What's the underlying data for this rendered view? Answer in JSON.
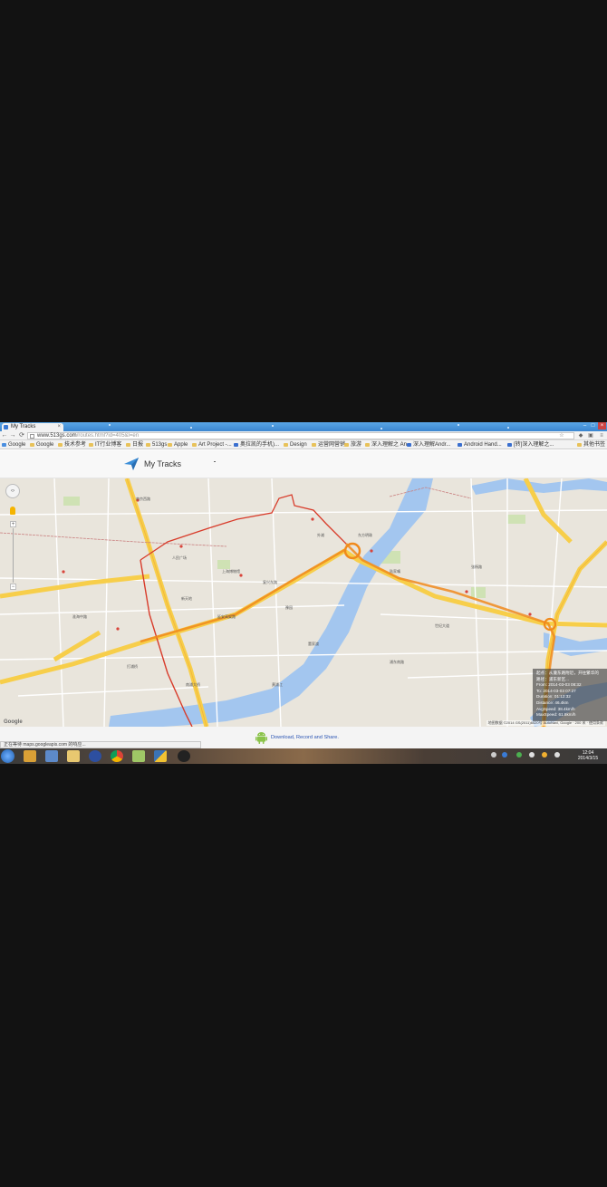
{
  "browser": {
    "tab_title": "My Tracks",
    "tab_close": "×",
    "url_host": "www.513gs.com",
    "url_path": "/routes.html?id=405&l=en",
    "nav": {
      "back": "←",
      "forward": "→",
      "reload": "⟳"
    },
    "window_controls": {
      "minimize": "–",
      "maximize": "□",
      "close": "×"
    },
    "bookmarks": [
      {
        "label": "Google",
        "icon": "google-icon"
      },
      {
        "label": "Google",
        "icon": "folder-icon"
      },
      {
        "label": "技术参考",
        "icon": "folder-icon"
      },
      {
        "label": "IT行业博客",
        "icon": "folder-icon"
      },
      {
        "label": "日报",
        "icon": "folder-icon"
      },
      {
        "label": "513gs",
        "icon": "folder-icon"
      },
      {
        "label": "Apple",
        "icon": "folder-icon"
      },
      {
        "label": "Art Project -...",
        "icon": "folder-icon"
      },
      {
        "label": "奥拉凯的手机)...",
        "icon": "page-icon"
      },
      {
        "label": "Design",
        "icon": "folder-icon"
      },
      {
        "label": "运营网营销",
        "icon": "folder-icon"
      },
      {
        "label": "旅游",
        "icon": "folder-icon"
      },
      {
        "label": "深入理解之 An...",
        "icon": "folder-icon"
      },
      {
        "label": "深入理解Andr...",
        "icon": "page-icon"
      },
      {
        "label": "Android Hand...",
        "icon": "page-icon"
      },
      {
        "label": "[转]深入理解之...",
        "icon": "page-icon"
      },
      {
        "label": "其他书签",
        "icon": "folder-icon"
      }
    ]
  },
  "page": {
    "title": "My Tracks",
    "footer_link": "Download, Record and Share."
  },
  "map": {
    "google_logo": "Google",
    "copyright": "地图数据 ©2014 GS(2011)6020号 AutoNavi, Google · 200 米 · 使用条款",
    "zoom_in": "+",
    "zoom_out": "−",
    "labels": [
      "南京西路",
      "人民广场",
      "外滩",
      "陆家嘴",
      "黄浦江",
      "延安高架路",
      "淮海中路",
      "豫园",
      "南浦大桥",
      "世纪大道",
      "东方明珠",
      "新天地",
      "打浦桥",
      "董家渡",
      "复兴东路",
      "浦东南路",
      "上海博物馆",
      "张杨路"
    ],
    "info": {
      "line1": "起点：从遵东路附近，开往繁华的",
      "line2": "路径：浦东新区...",
      "from": "From: 2014-03-03 08:32",
      "to": "To: 2014-03-03 07:27",
      "duration": "Duration: 01:12:32",
      "distance": "Distance: 46.4km",
      "avg_speed": "AvgSpeed: 38.4km/h",
      "max_speed": "MaxSpeed: 61.8km/h"
    }
  },
  "statusbar": {
    "text": "正在等待 maps.googleapis.com 的响应..."
  },
  "taskbar": {
    "time": "12:04",
    "date": "2014/3/15"
  }
}
